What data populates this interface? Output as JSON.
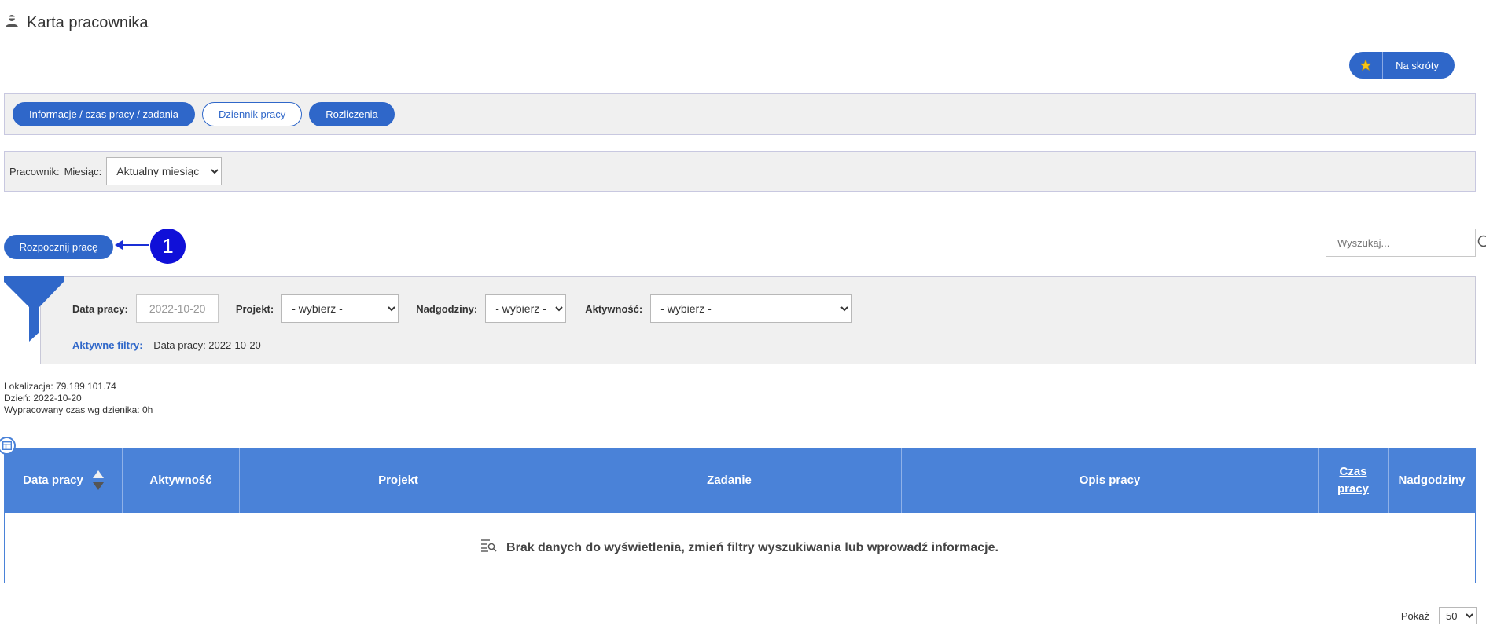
{
  "page": {
    "title": "Karta pracownika",
    "icon": "user-icon"
  },
  "shortcut": {
    "label": "Na skróty",
    "icon": "star-icon"
  },
  "tabs": [
    {
      "label": "Informacje / czas pracy / zadania",
      "style": "filled"
    },
    {
      "label": "Dziennik pracy",
      "style": "outline"
    },
    {
      "label": "Rozliczenia",
      "style": "filled"
    }
  ],
  "employee_bar": {
    "employee_label": "Pracownik:",
    "month_label": "Miesiąc:",
    "month_value": "Aktualny miesiąc"
  },
  "start_button": {
    "label": "Rozpocznij pracę"
  },
  "annotation": {
    "number": "1"
  },
  "search": {
    "placeholder": "Wyszukaj...",
    "icon": "search-icon"
  },
  "filters": {
    "date": {
      "label": "Data pracy:",
      "value": "2022-10-20"
    },
    "project": {
      "label": "Projekt:",
      "value": "- wybierz -"
    },
    "overtime": {
      "label": "Nadgodziny:",
      "value": "- wybierz -"
    },
    "activity": {
      "label": "Aktywność:",
      "value": "- wybierz -"
    },
    "active_label": "Aktywne filtry:",
    "active_value": "Data pracy: 2022-10-20"
  },
  "info": {
    "location": "Lokalizacja: 79.189.101.74",
    "day": "Dzień: 2022-10-20",
    "worked": "Wypracowany czas wg dzienika: 0h"
  },
  "table": {
    "columns": {
      "date": "Data pracy",
      "activity": "Aktywność",
      "project": "Projekt",
      "task": "Zadanie",
      "description": "Opis pracy",
      "time_line1": "Czas",
      "time_line2": "pracy",
      "overtime": "Nadgodziny"
    },
    "empty_message": "Brak danych do wyświetlenia, zmień filtry wyszukiwania lub wprowadź informacje."
  },
  "pager": {
    "label": "Pokaż",
    "value": "50"
  },
  "colors": {
    "primary": "#2f67c9",
    "table_header": "#4a82d8",
    "panel_bg": "#f0f0f0",
    "badge": "#1010d8"
  }
}
